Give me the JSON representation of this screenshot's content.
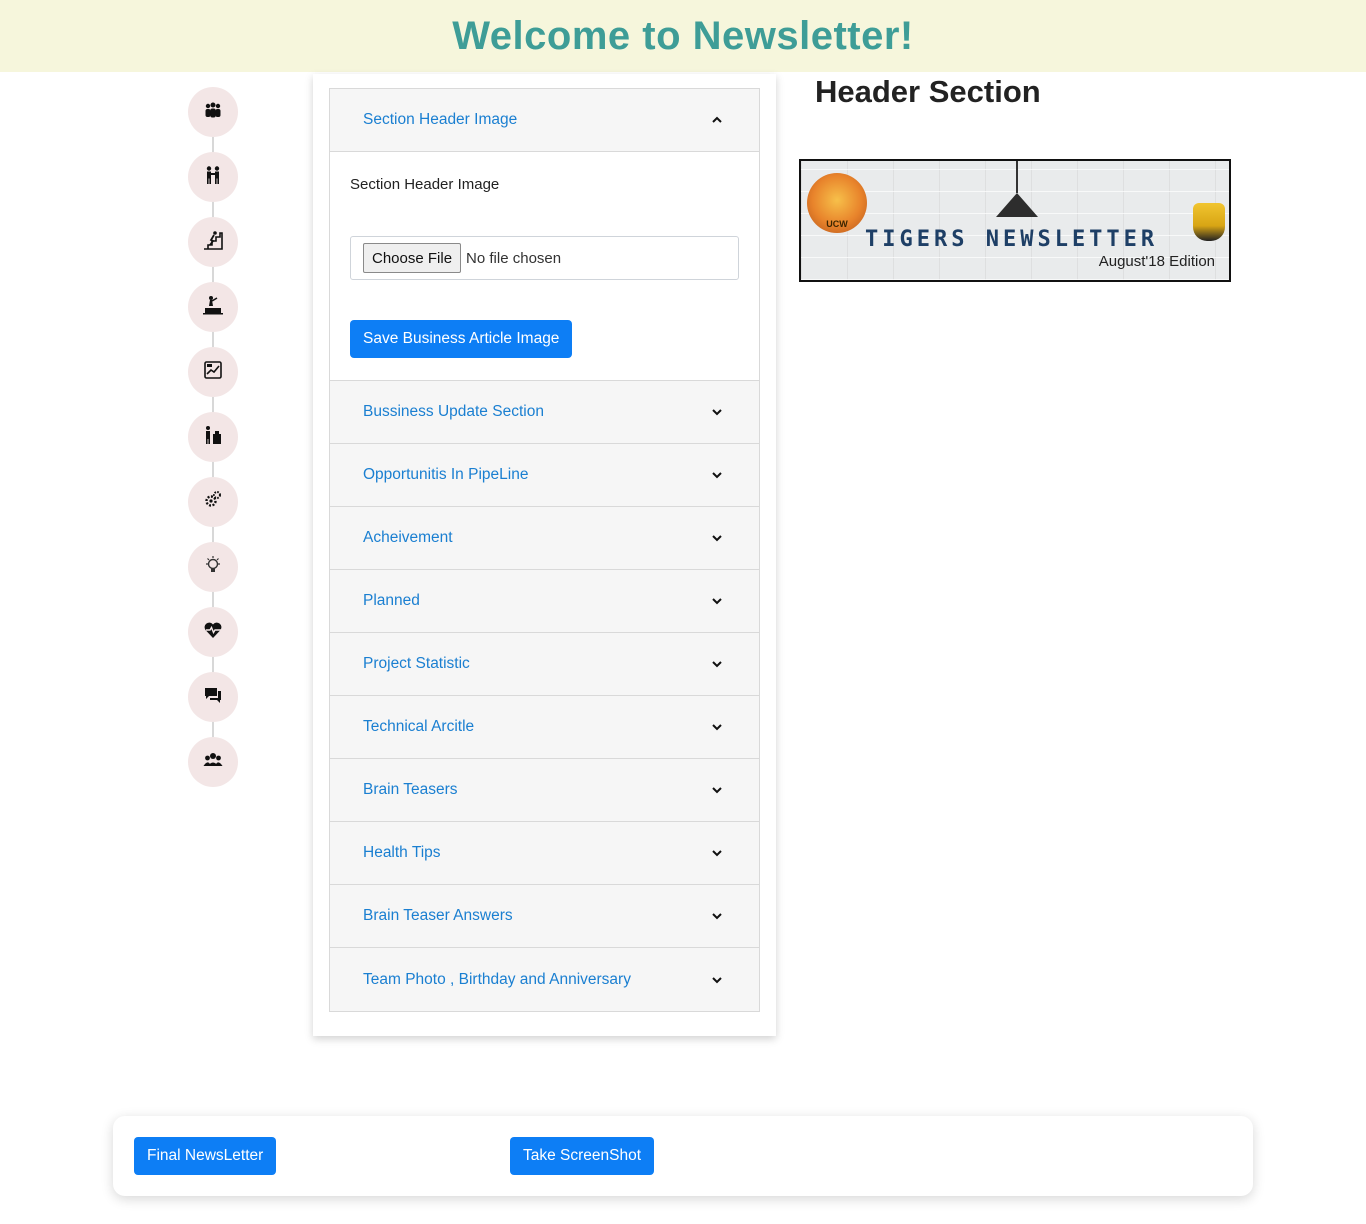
{
  "header": {
    "title": "Welcome to Newsletter!"
  },
  "timeline": {
    "items": [
      {
        "icon": "group-icon"
      },
      {
        "icon": "handshake-icon"
      },
      {
        "icon": "stairs-climb-icon"
      },
      {
        "icon": "podium-icon"
      },
      {
        "icon": "chart-report-icon"
      },
      {
        "icon": "presenter-icon"
      },
      {
        "icon": "gears-icon"
      },
      {
        "icon": "lightbulb-icon"
      },
      {
        "icon": "heart-pulse-icon"
      },
      {
        "icon": "chat-bubbles-icon"
      },
      {
        "icon": "team-icon"
      }
    ]
  },
  "accordion": {
    "open_section": {
      "title": "Section Header Image",
      "label": "Section Header Image",
      "file_button": "Choose File",
      "file_status": "No file chosen",
      "save_button": "Save Business Article Image"
    },
    "sections": [
      "Bussiness Update Section",
      "Opportunitis In PipeLine",
      "Acheivement",
      "Planned",
      "Project Statistic",
      "Technical Arcitle",
      "Brain Teasers",
      "Health Tips",
      "Brain Teaser Answers",
      "Team Photo , Birthday and Anniversary"
    ]
  },
  "preview": {
    "title": "Header Section",
    "banner": {
      "seal_text": "UCW",
      "title": "TIGERS NEWSLETTER",
      "edition": "August'18 Edition"
    }
  },
  "footer": {
    "final_button": "Final NewsLetter",
    "screenshot_button": "Take ScreenShot"
  },
  "colors": {
    "banner_bg": "#f6f6dc",
    "title_teal": "#3e9d97",
    "link_blue": "#1a7fd1",
    "button_blue": "#0d7ef5",
    "timeline_circle": "#f3e6e6"
  }
}
